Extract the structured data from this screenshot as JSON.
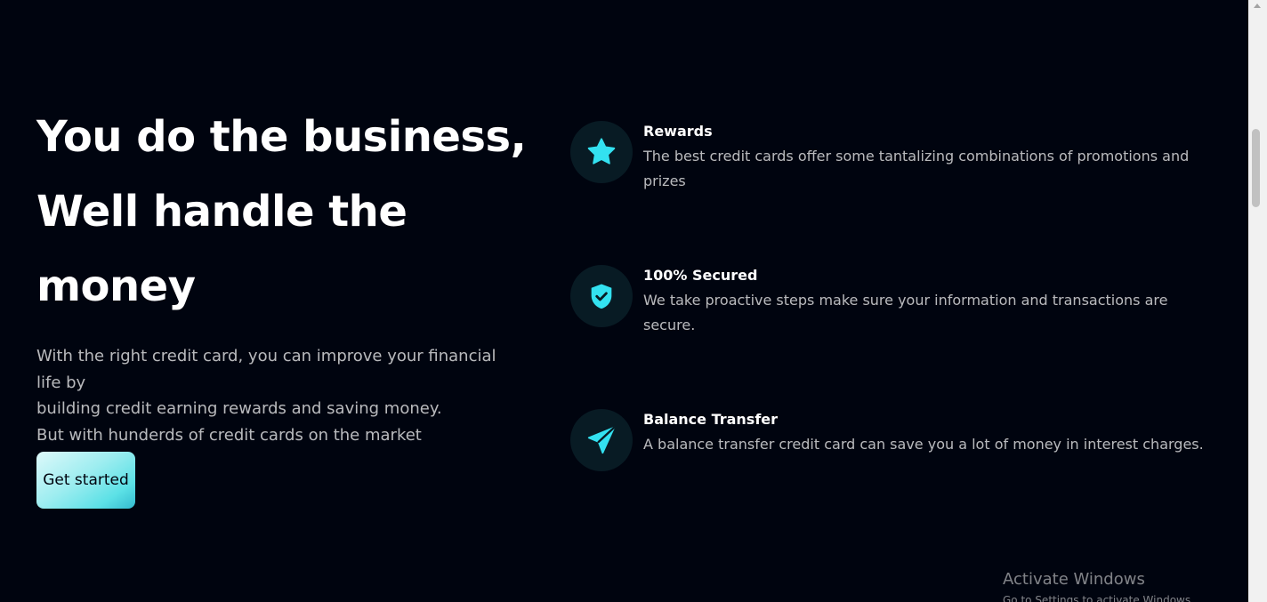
{
  "hero": {
    "title_lines": [
      "You do the business,",
      "Well handle the",
      "money"
    ],
    "description_lines": [
      "With the right credit card, you can improve your financial",
      "life by",
      "building credit earning rewards and saving money.",
      "But with hunderds of credit cards on the market"
    ],
    "cta_label": "Get started"
  },
  "features": [
    {
      "icon": "star-icon",
      "title": "Rewards",
      "description": "The best credit cards offer some tantalizing combinations of promotions and prizes"
    },
    {
      "icon": "shield-check-icon",
      "title": "100% Secured",
      "description": "We take proactive steps make sure your information and transactions are secure."
    },
    {
      "icon": "send-icon",
      "title": "Balance Transfer",
      "description": "A balance transfer credit card can save you a lot of money in interest charges."
    }
  ],
  "watermark": {
    "title": "Activate Windows",
    "subtitle": "Go to Settings to activate Windows."
  },
  "colors": {
    "background": "#00040f",
    "accent": "#33e1f0",
    "icon_circle": "#081b24"
  }
}
